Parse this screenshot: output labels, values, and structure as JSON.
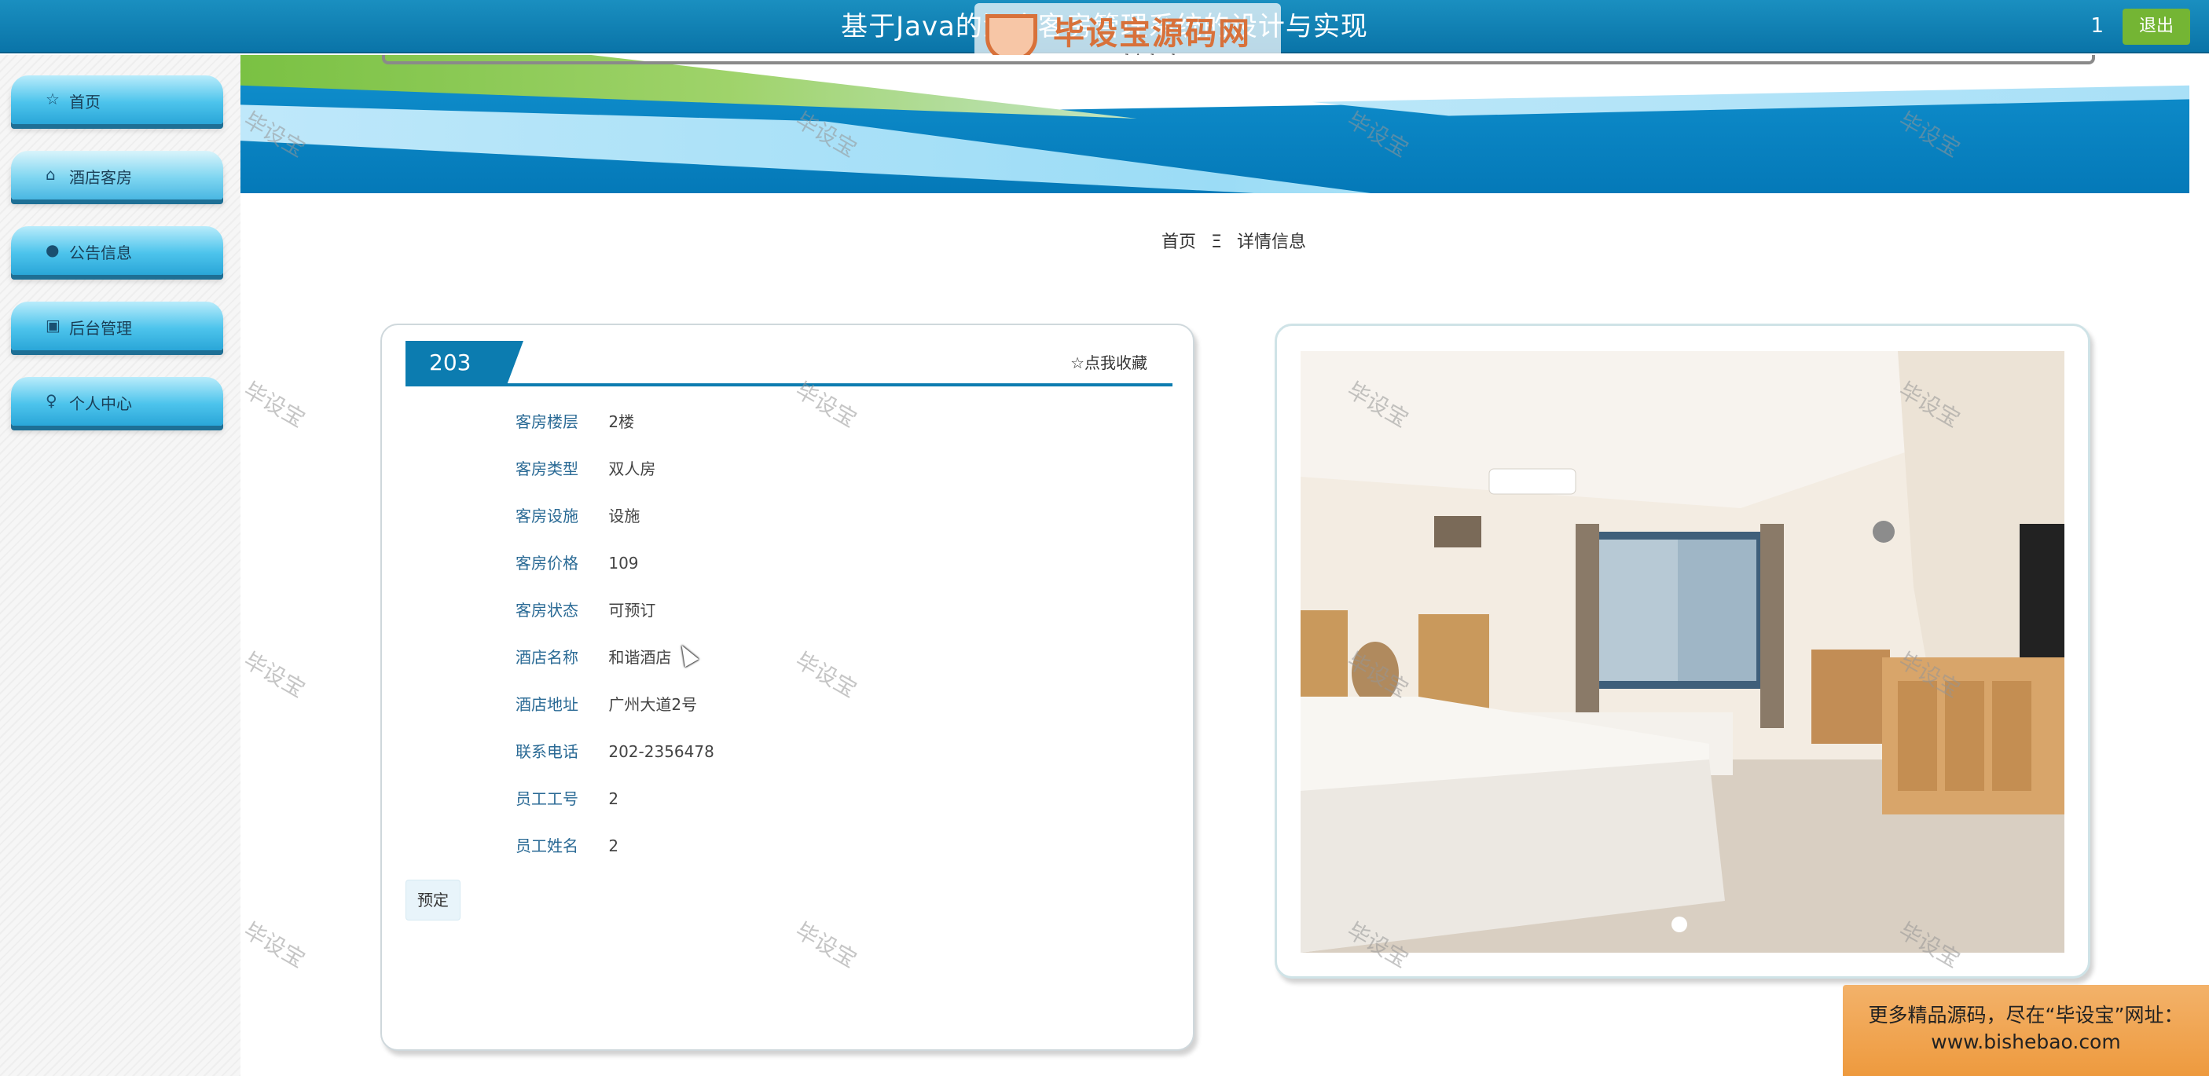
{
  "header": {
    "title": "基于Java的酒店客房管理系统的设计与实现",
    "user": "1",
    "logout_label": "退出"
  },
  "watermark_logo": {
    "name": "毕设宝源码网",
    "url": "www.bishebao.com"
  },
  "sidebar": {
    "items": [
      {
        "icon": "star-icon",
        "glyph": "☆",
        "label": "首页"
      },
      {
        "icon": "bag-icon",
        "glyph": "⌂",
        "label": "酒店客房"
      },
      {
        "icon": "alert-icon",
        "glyph": "●",
        "label": "公告信息"
      },
      {
        "icon": "briefcase-icon",
        "glyph": "▣",
        "label": "后台管理"
      },
      {
        "icon": "person-icon",
        "glyph": "♀",
        "label": "个人中心"
      }
    ]
  },
  "breadcrumb": {
    "home": "首页",
    "separator": "Ξ",
    "current": "详情信息"
  },
  "detail": {
    "room_number": "203",
    "favorite_label": "☆点我收藏",
    "fields": [
      {
        "label": "客房楼层",
        "value": "2楼"
      },
      {
        "label": "客房类型",
        "value": "双人房"
      },
      {
        "label": "客房设施",
        "value": "设施"
      },
      {
        "label": "客房价格",
        "value": "109"
      },
      {
        "label": "客房状态",
        "value": "可预订"
      },
      {
        "label": "酒店名称",
        "value": "和谐酒店"
      },
      {
        "label": "酒店地址",
        "value": "广州大道2号"
      },
      {
        "label": "联系电话",
        "value": "202-2356478"
      },
      {
        "label": "员工工号",
        "value": "2"
      },
      {
        "label": "员工姓名",
        "value": "2"
      }
    ],
    "book_label": "预定"
  },
  "ad": {
    "line1": "更多精品源码，尽在“毕设宝”网址：",
    "line2": "www.bishebao.com"
  },
  "watermark_text": "毕设宝",
  "colors": {
    "header_blue": "#0a74a8",
    "accent_blue": "#0c7cb0",
    "logout_green": "#74b534",
    "ad_orange": "#ee9a3e"
  }
}
